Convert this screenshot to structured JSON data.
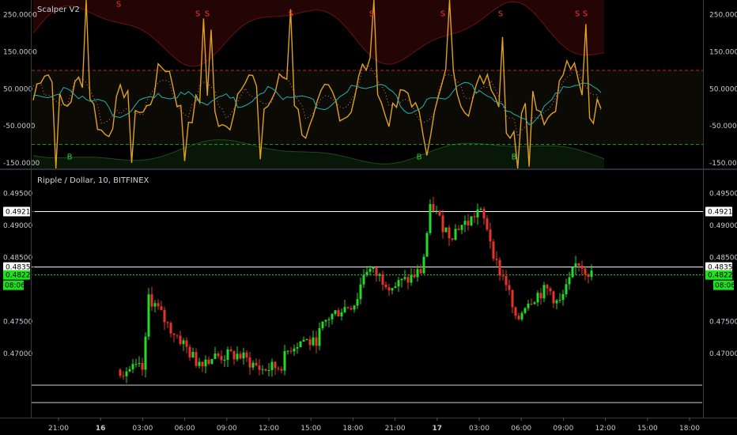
{
  "indicator_pane": {
    "title": "Scalper V2",
    "y_ticks": [
      "250.0000",
      "150.0000",
      "50.0000",
      "-50.0000",
      "-150.0000"
    ],
    "y_tick_values": [
      250,
      150,
      50,
      -50,
      -150
    ],
    "ylim": [
      -165,
      290
    ],
    "upper_threshold": 100,
    "lower_threshold": -100,
    "signals": [
      {
        "label": "S",
        "x": 150,
        "y": 280
      },
      {
        "label": "S",
        "x": 250,
        "y": 255
      },
      {
        "label": "S",
        "x": 262,
        "y": 255
      },
      {
        "label": "S",
        "x": 368,
        "y": 255
      },
      {
        "label": "S",
        "x": 470,
        "y": 255
      },
      {
        "label": "S",
        "x": 560,
        "y": 255
      },
      {
        "label": "S",
        "x": 633,
        "y": 255
      },
      {
        "label": "S",
        "x": 730,
        "y": 255
      },
      {
        "label": "S",
        "x": 740,
        "y": 255
      },
      {
        "label": "B",
        "x": 88,
        "y": -132
      },
      {
        "label": "B",
        "x": 530,
        "y": -132
      },
      {
        "label": "B",
        "x": 650,
        "y": -132
      }
    ],
    "colors": {
      "osc": "#e0a020",
      "ma": "#20b0b0",
      "signal_s": "#ff3030",
      "signal_b": "#30d030",
      "dots": "#e87070"
    }
  },
  "price_pane": {
    "title": "Ripple / Dollar, 10, BITFINEX",
    "y_ticks": [
      "0.49500",
      "0.49000",
      "0.48500",
      "0.47500",
      "0.47000"
    ],
    "y_tick_values": [
      0.495,
      0.49,
      0.485,
      0.475,
      0.47
    ],
    "ylim": [
      0.4652,
      0.4983
    ],
    "h_levels": [
      0.49219,
      0.48353
    ],
    "last_price": 0.48229,
    "labels": {
      "level1": "0.49219",
      "level2": "0.48353",
      "last": "0.48229",
      "countdown": "08:06"
    },
    "colors": {
      "up": "#26d82a",
      "down": "#e8332b",
      "last": "#1fe01f"
    }
  },
  "x_axis": {
    "ticks": [
      "21:00",
      "16",
      "03:00",
      "06:00",
      "09:00",
      "12:00",
      "15:00",
      "18:00",
      "21:00",
      "17",
      "03:00",
      "06:00",
      "09:00",
      "12:00",
      "15:00",
      "18:00"
    ],
    "bold": [
      false,
      true,
      false,
      false,
      false,
      false,
      false,
      false,
      false,
      true,
      false,
      false,
      false,
      false,
      false,
      false
    ]
  },
  "chart_data": {
    "type": "candlestick",
    "title": "Ripple / Dollar, 10, BITFINEX",
    "interval": "10",
    "x_ticks": [
      "21:00",
      "16",
      "03:00",
      "06:00",
      "09:00",
      "12:00",
      "15:00",
      "18:00",
      "21:00",
      "17",
      "03:00",
      "06:00",
      "09:00",
      "12:00",
      "15:00",
      "18:00"
    ],
    "price_path": [
      {
        "t": 0.0,
        "p": 0.4675
      },
      {
        "t": 0.05,
        "p": 0.4675
      },
      {
        "t": 0.06,
        "p": 0.479
      },
      {
        "t": 0.07,
        "p": 0.478
      },
      {
        "t": 0.1,
        "p": 0.4745
      },
      {
        "t": 0.13,
        "p": 0.472
      },
      {
        "t": 0.16,
        "p": 0.4688
      },
      {
        "t": 0.2,
        "p": 0.4695
      },
      {
        "t": 0.25,
        "p": 0.4698
      },
      {
        "t": 0.3,
        "p": 0.4675
      },
      {
        "t": 0.34,
        "p": 0.468
      },
      {
        "t": 0.36,
        "p": 0.471
      },
      {
        "t": 0.39,
        "p": 0.4722
      },
      {
        "t": 0.41,
        "p": 0.4715
      },
      {
        "t": 0.44,
        "p": 0.4755
      },
      {
        "t": 0.47,
        "p": 0.477
      },
      {
        "t": 0.5,
        "p": 0.478
      },
      {
        "t": 0.52,
        "p": 0.4835
      },
      {
        "t": 0.55,
        "p": 0.482
      },
      {
        "t": 0.58,
        "p": 0.4805
      },
      {
        "t": 0.61,
        "p": 0.4815
      },
      {
        "t": 0.64,
        "p": 0.483
      },
      {
        "t": 0.66,
        "p": 0.4935
      },
      {
        "t": 0.68,
        "p": 0.4905
      },
      {
        "t": 0.7,
        "p": 0.4885
      },
      {
        "t": 0.72,
        "p": 0.49
      },
      {
        "t": 0.74,
        "p": 0.4905
      },
      {
        "t": 0.76,
        "p": 0.4925
      },
      {
        "t": 0.78,
        "p": 0.4895
      },
      {
        "t": 0.8,
        "p": 0.4835
      },
      {
        "t": 0.82,
        "p": 0.481
      },
      {
        "t": 0.84,
        "p": 0.4745
      },
      {
        "t": 0.86,
        "p": 0.478
      },
      {
        "t": 0.89,
        "p": 0.4795
      },
      {
        "t": 0.91,
        "p": 0.48
      },
      {
        "t": 0.93,
        "p": 0.4775
      },
      {
        "t": 0.95,
        "p": 0.4805
      },
      {
        "t": 0.97,
        "p": 0.4845
      },
      {
        "t": 1.0,
        "p": 0.4823
      }
    ],
    "h_levels": [
      0.49219,
      0.48353
    ],
    "last_price": 0.48229
  }
}
